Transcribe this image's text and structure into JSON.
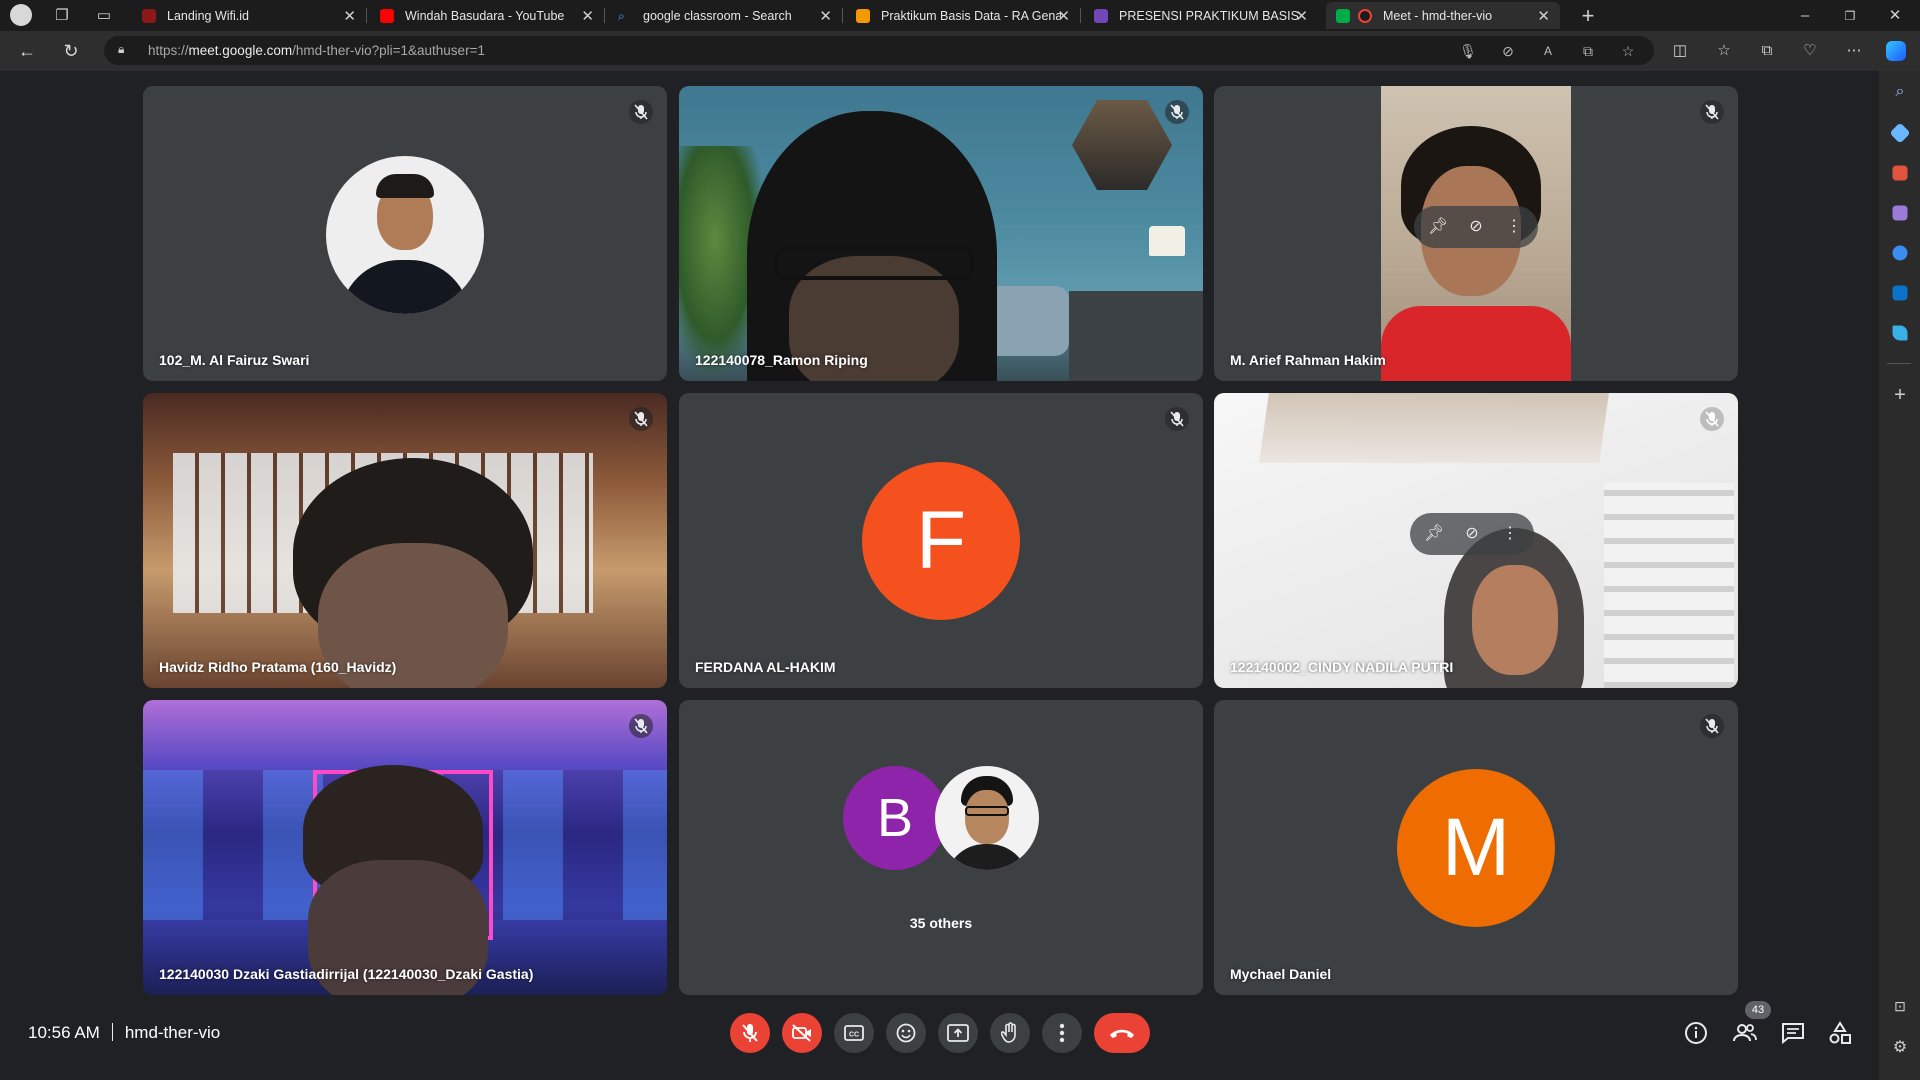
{
  "browser": {
    "tabs": [
      {
        "title": "Landing Wifi.id",
        "favicon_color": "#8a1a1a"
      },
      {
        "title": "Windah Basudara - YouTube",
        "favicon_color": "#ff0000"
      },
      {
        "title": "google classroom - Search",
        "favicon_color": "#4da3ff"
      },
      {
        "title": "Praktikum Basis Data - RA Genap",
        "favicon_color": "#f29900"
      },
      {
        "title": "PRESENSI PRAKTIKUM BASIS DATA",
        "favicon_color": "#7248b9"
      },
      {
        "title": "Meet - hmd-ther-vio",
        "favicon_color": "#00ac47"
      }
    ],
    "url_prefix": "https://",
    "url_host": "meet.google.com",
    "url_path": "/hmd-ther-vio?pli=1&authuser=1"
  },
  "participants": [
    {
      "name": "102_M. Al Fairuz Swari",
      "type": "photo"
    },
    {
      "name": "122140078_Ramon Riping",
      "type": "video"
    },
    {
      "name": "M. Arief Rahman Hakim",
      "type": "video"
    },
    {
      "name": "Havidz Ridho Pratama (160_Havidz)",
      "type": "video"
    },
    {
      "name": "FERDANA AL-HAKIM",
      "type": "letter",
      "letter": "F",
      "color": "#f4511e"
    },
    {
      "name": "122140002_CINDY NADILA PUTRI",
      "type": "video"
    },
    {
      "name": "122140030 Dzaki Gastiadirrijal (122140030_Dzaki Gastia)",
      "type": "video"
    },
    {
      "name": "35 others",
      "type": "group",
      "letter": "B",
      "color": "#8e24aa"
    },
    {
      "name": "Mychael Daniel",
      "type": "letter",
      "letter": "M",
      "color": "#ef6c00"
    }
  ],
  "bottom_bar": {
    "time": "10:56 AM",
    "meeting_code": "hmd-ther-vio",
    "people_count": "43"
  },
  "colors": {
    "background": "#202124",
    "tile": "#3c4043",
    "end_call": "#ea4335"
  }
}
